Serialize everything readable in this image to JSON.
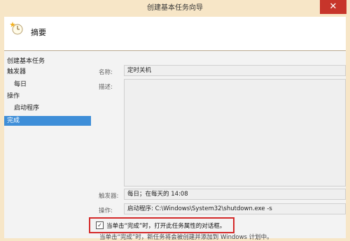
{
  "window": {
    "title": "创建基本任务向导",
    "close_label": "✕"
  },
  "header": {
    "title": "摘要",
    "icon": "clock-star-icon"
  },
  "nav": {
    "items": [
      {
        "label": "创建基本任务"
      },
      {
        "label": "触发器"
      },
      {
        "label": "每日"
      },
      {
        "label": "操作"
      },
      {
        "label": "启动程序"
      },
      {
        "label": "完成"
      }
    ]
  },
  "summary": {
    "name_label": "名称:",
    "name_value": "定时关机",
    "desc_label": "描述:",
    "desc_value": "",
    "trigger_label": "触发器:",
    "trigger_value": "每日；在每天的 14:08",
    "action_label": "操作:",
    "action_value": "启动程序: C:\\Windows\\System32\\shutdown.exe -s"
  },
  "open_props": {
    "checked": true,
    "label": "当单击“完成”时，打开此任务属性的对话框。"
  },
  "note": "当单击“完成”时，新任务将会被创建并添加到 Windows 计划中。",
  "colors": {
    "frame": "#f7e6c7",
    "selection": "#3e8ed8",
    "close": "#c7352b",
    "highlight": "#d42a2a"
  }
}
